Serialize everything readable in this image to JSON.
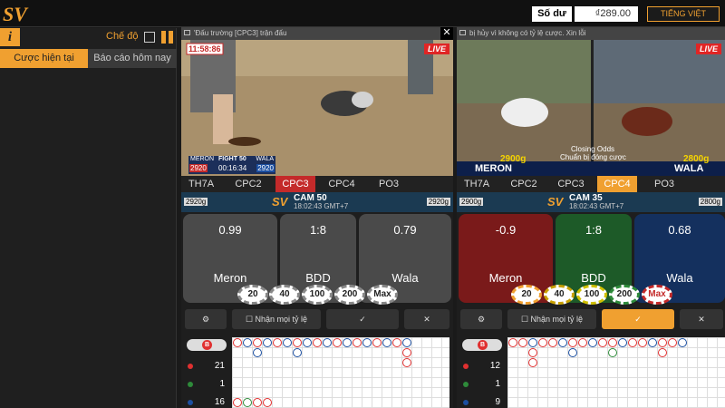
{
  "header": {
    "logo_text": "SV",
    "balance_label": "Số dư",
    "balance_value": "₫289.00",
    "language": "TIẾNG VIỆT"
  },
  "sidebar": {
    "info_icon": "i",
    "mode_label": "Chế độ",
    "tabs": [
      {
        "label": "Cược hiện tại"
      },
      {
        "label": "Báo cáo hôm nay"
      }
    ]
  },
  "panels": [
    {
      "title": "'Đấu trường [CPC3] trận đấu",
      "live": "LIVE",
      "video_time": "11:58:86",
      "overlay": {
        "meron": "MERON",
        "fight": "FIGHT 50",
        "wala": "WALA",
        "meron_odds": "2920",
        "timer": "00:16:34",
        "wala_odds": "2920"
      },
      "tabs": [
        "TH7A",
        "CPC2",
        "CPC3",
        "CPC4",
        "PO3"
      ],
      "active_tab": 2,
      "fight": {
        "cam": "CAM 50",
        "time": "18:02:43 GMT+7",
        "left": "2920g",
        "right": "2920g",
        "sv": "SV"
      },
      "bets": [
        {
          "odd": "0.99",
          "label": "Meron"
        },
        {
          "odd": "1:8",
          "label": "BDD"
        },
        {
          "odd": "0.79",
          "label": "Wala"
        }
      ],
      "chips": [
        "20",
        "40",
        "100",
        "200",
        "Max"
      ],
      "accept": "Nhận mọi tỷ lệ",
      "stats": [
        {
          "value": "21"
        },
        {
          "value": "1"
        },
        {
          "value": "16"
        }
      ]
    },
    {
      "title": "bị hủy vì không có tỷ lệ cược. Xin lỗi",
      "live": "LIVE",
      "overlay": {
        "left": "2900g",
        "right": "2800g",
        "closing": "Closing Odds",
        "prepare": "Chuẩn bị đóng cược",
        "meron": "MERON",
        "wala": "WALA"
      },
      "tabs": [
        "TH7A",
        "CPC2",
        "CPC3",
        "CPC4",
        "PO3"
      ],
      "active_tab": 3,
      "fight": {
        "cam": "CAM 35",
        "time": "18:02:43 GMT+7",
        "left": "2900g",
        "right": "2800g",
        "sv": "SV"
      },
      "bets": [
        {
          "odd": "-0.9",
          "label": "Meron"
        },
        {
          "odd": "1:8",
          "label": "BDD"
        },
        {
          "odd": "0.68",
          "label": "Wala"
        }
      ],
      "chips": [
        "20",
        "40",
        "100",
        "200",
        "Max"
      ],
      "accept": "Nhận mọi tỷ lệ",
      "stats": [
        {
          "value": "12"
        },
        {
          "value": "1"
        },
        {
          "value": "9"
        }
      ]
    }
  ],
  "road_marker": "B",
  "colors": {
    "accent": "#f0a030",
    "meron": "#c42a2a",
    "wala": "#1c4fa0",
    "bdd": "#2e8b3a"
  }
}
